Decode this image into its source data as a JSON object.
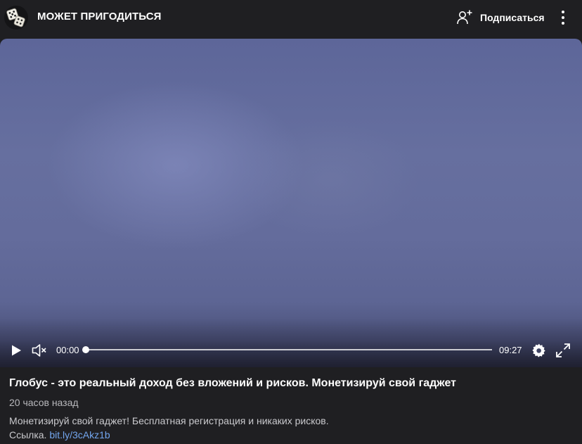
{
  "header": {
    "channel_name": "МОЖЕТ ПРИГОДИТЬСЯ",
    "avatar_icon": "dice-icon",
    "subscribe_icon": "add-user-icon",
    "subscribe_label": "Подписаться",
    "more_icon": "vertical-dots-icon"
  },
  "player": {
    "play_icon": "play-icon",
    "mute_icon": "speaker-muted-icon",
    "current_time": "00:00",
    "duration": "09:27",
    "progress_fraction": 0.0,
    "settings_icon": "gear-icon",
    "fullscreen_icon": "expand-icon"
  },
  "video_info": {
    "title": "Глобус - это реальный доход без вложений и рисков. Монетизируй свой гаджет",
    "posted": "20 часов назад",
    "description": "Монетизируй свой гаджет! Бесплатная регистрация и никаких рисков.",
    "link_prefix": "Ссылка.",
    "link_text": "bit.ly/3cAkz1b"
  },
  "colors": {
    "background": "#1f1f22",
    "link": "#73a6ee",
    "video_tint": "#656e9f"
  }
}
